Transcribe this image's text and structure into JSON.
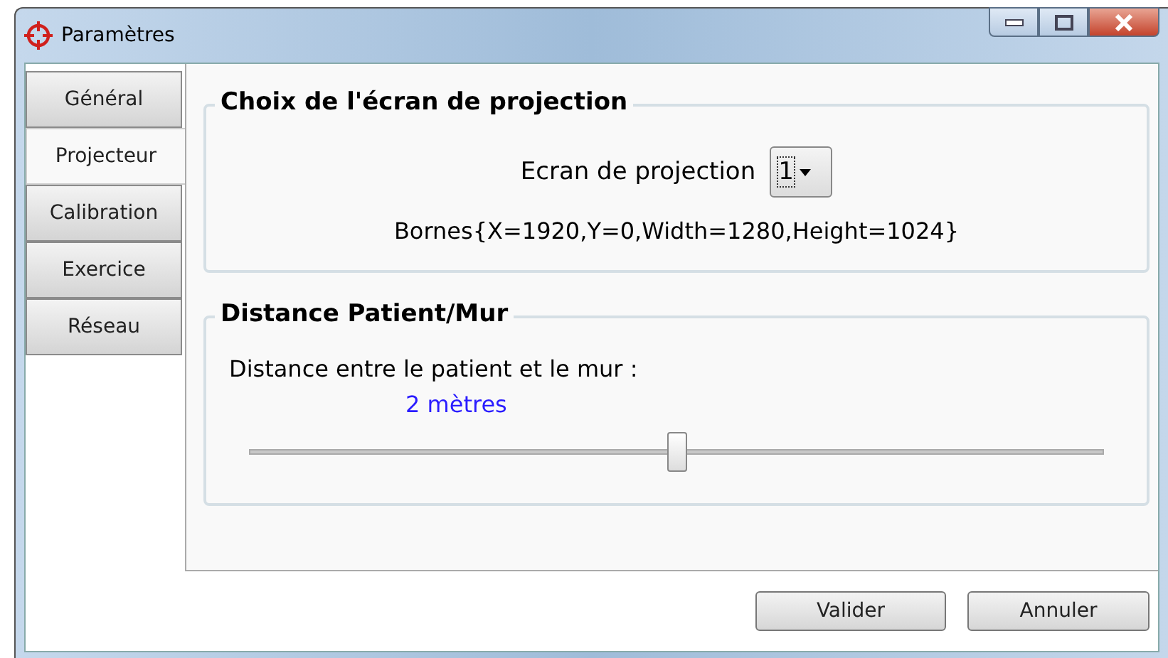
{
  "window": {
    "title": "Paramètres"
  },
  "tabs": [
    {
      "label": "Général",
      "selected": false
    },
    {
      "label": "Projecteur",
      "selected": true
    },
    {
      "label": "Calibration",
      "selected": false
    },
    {
      "label": "Exercice",
      "selected": false
    },
    {
      "label": "Réseau",
      "selected": false
    }
  ],
  "projection_group": {
    "title": "Choix de l'écran de projection",
    "screen_label": "Ecran de projection",
    "screen_value": "1",
    "bounds": "Bornes{X=1920,Y=0,Width=1280,Height=1024}"
  },
  "distance_group": {
    "title": "Distance Patient/Mur",
    "label": "Distance entre le patient et le mur :",
    "reading": "2 mètres",
    "level": 0.5
  },
  "buttons": [
    "Valider",
    "Annuler"
  ]
}
